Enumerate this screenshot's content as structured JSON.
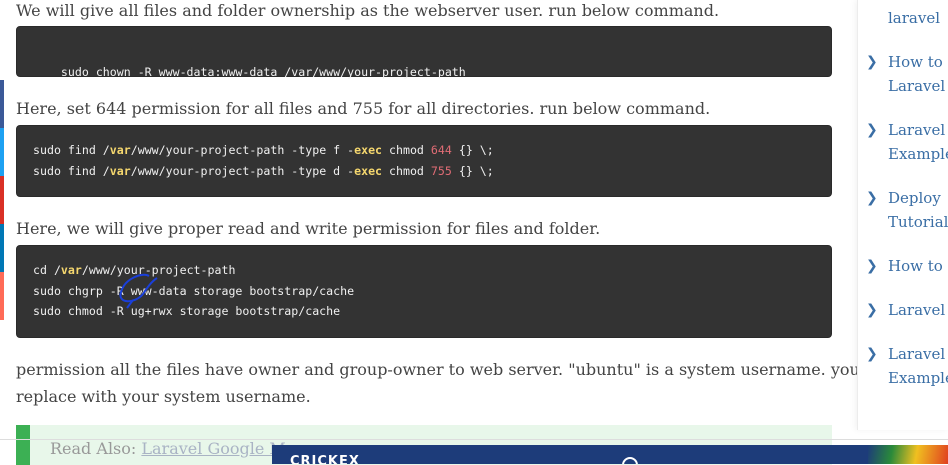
{
  "content": {
    "para1": "We will give all files and folder ownership as the webserver user. run below command.",
    "code1": {
      "line1": "sudo chown -R www-data:www-data /var/www/your-project-path"
    },
    "para2": "Here, set 644 permission for all files and 755 for all directories. run below command.",
    "code2": {
      "l1_a": "sudo find /",
      "l1_var": "var",
      "l1_b": "/www/your-project-path -type f -",
      "l1_exec": "exec",
      "l1_c": " chmod ",
      "l1_num": "644",
      "l1_d": " {} \\;",
      "l2_a": "sudo find /",
      "l2_var": "var",
      "l2_b": "/www/your-project-path -type d -",
      "l2_exec": "exec",
      "l2_c": " chmod ",
      "l2_num": "755",
      "l2_d": " {} \\;"
    },
    "para3": "Here, we will give proper read and write permission for files and folder.",
    "code3": {
      "l1_a": "cd /",
      "l1_var": "var",
      "l1_b": "/www/your-project-path",
      "l2": "sudo chgrp -R www-data storage bootstrap/cache",
      "l3": "sudo chmod -R ug+rwx storage bootstrap/cache"
    },
    "para4_line1": "permission all the files have owner and group-owner to web server. \"ubuntu\" is a system username. you have to",
    "para4_line2": "replace with your system username.",
    "read_also_label": "Read Also:",
    "read_also_link": "Laravel Google M"
  },
  "sidebar": {
    "items": [
      {
        "l1": "laravel",
        "l2": ""
      },
      {
        "l1": "How to",
        "l2": "Laravel"
      },
      {
        "l1": "Laravel",
        "l2": "Example"
      },
      {
        "l1": "Deploy",
        "l2": "Tutorial"
      },
      {
        "l1": "How to",
        "l2": ""
      },
      {
        "l1": "Laravel",
        "l2": ""
      },
      {
        "l1": "Laravel",
        "l2": "Example"
      }
    ],
    "chevron": "❯"
  },
  "ad": {
    "brand": "CRICKEX"
  },
  "colors": {
    "code_bg": "#333333",
    "keyword": "#f5d76e",
    "number": "#e06c75",
    "link": "#3a6ea5",
    "note_border": "#3cb054"
  }
}
